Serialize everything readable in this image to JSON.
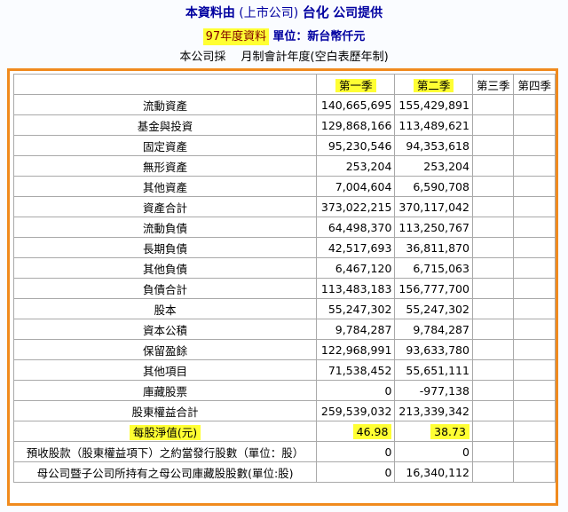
{
  "header": {
    "source_prefix": "本資料由",
    "listing": "(上市公司)",
    "company": "台化",
    "source_suffix": "公司提供",
    "year_label": "97年度資料",
    "unit": "單位：新台幣仟元",
    "fiscal_note": "本公司採　 月制會計年度(空白表歷年制)"
  },
  "table": {
    "columns": [
      "",
      "第一季",
      "第二季",
      "第三季",
      "第四季"
    ],
    "rows": [
      {
        "label": "流動資產",
        "q1": "140,665,695",
        "q2": "155,429,891",
        "q3": "",
        "q4": ""
      },
      {
        "label": "基金與投資",
        "q1": "129,868,166",
        "q2": "113,489,621",
        "q3": "",
        "q4": ""
      },
      {
        "label": "固定資產",
        "q1": "95,230,546",
        "q2": "94,353,618",
        "q3": "",
        "q4": ""
      },
      {
        "label": "無形資產",
        "q1": "253,204",
        "q2": "253,204",
        "q3": "",
        "q4": ""
      },
      {
        "label": "其他資產",
        "q1": "7,004,604",
        "q2": "6,590,708",
        "q3": "",
        "q4": ""
      },
      {
        "label": "資產合計",
        "q1": "373,022,215",
        "q2": "370,117,042",
        "q3": "",
        "q4": ""
      },
      {
        "label": "流動負債",
        "q1": "64,498,370",
        "q2": "113,250,767",
        "q3": "",
        "q4": ""
      },
      {
        "label": "長期負債",
        "q1": "42,517,693",
        "q2": "36,811,870",
        "q3": "",
        "q4": ""
      },
      {
        "label": "其他負債",
        "q1": "6,467,120",
        "q2": "6,715,063",
        "q3": "",
        "q4": ""
      },
      {
        "label": "負債合計",
        "q1": "113,483,183",
        "q2": "156,777,700",
        "q3": "",
        "q4": ""
      },
      {
        "label": "股本",
        "q1": "55,247,302",
        "q2": "55,247,302",
        "q3": "",
        "q4": ""
      },
      {
        "label": "資本公積",
        "q1": "9,784,287",
        "q2": "9,784,287",
        "q3": "",
        "q4": ""
      },
      {
        "label": "保留盈餘",
        "q1": "122,968,991",
        "q2": "93,633,780",
        "q3": "",
        "q4": ""
      },
      {
        "label": "其他項目",
        "q1": "71,538,452",
        "q2": "55,651,111",
        "q3": "",
        "q4": ""
      },
      {
        "label": "庫藏股票",
        "q1": "0",
        "q2": "-977,138",
        "q3": "",
        "q4": ""
      },
      {
        "label": "股東權益合計",
        "q1": "259,539,032",
        "q2": "213,339,342",
        "q3": "",
        "q4": ""
      },
      {
        "label": "每股淨值(元)",
        "q1": "46.98",
        "q2": "38.73",
        "q3": "",
        "q4": "",
        "highlight": true
      },
      {
        "label": "預收股款（股東權益項下）之約當發行股數（單位：股）",
        "q1": "0",
        "q2": "0",
        "q3": "",
        "q4": ""
      },
      {
        "label": "母公司暨子公司所持有之母公司庫藏股股數(單位:股)",
        "q1": "0",
        "q2": "16,340,112",
        "q3": "",
        "q4": ""
      }
    ]
  }
}
